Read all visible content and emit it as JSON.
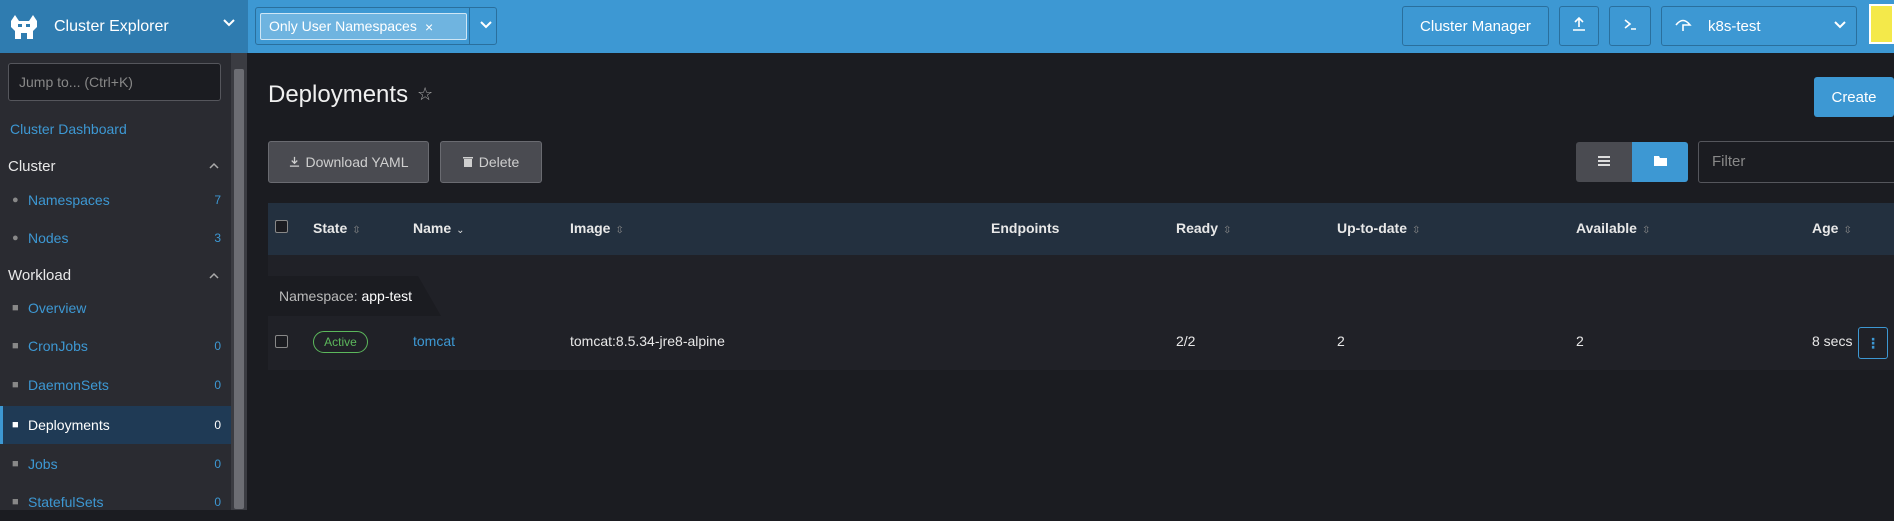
{
  "header": {
    "app_title": "Cluster Explorer",
    "namespace_filter": "Only User Namespaces",
    "namespace_remove": "×",
    "cluster_manager": "Cluster Manager",
    "cluster_name": "k8s-test"
  },
  "sidebar": {
    "jump_placeholder": "Jump to... (Ctrl+K)",
    "dashboard": "Cluster Dashboard",
    "groups": {
      "cluster": "Cluster",
      "workload": "Workload"
    },
    "cluster_items": [
      {
        "label": "Namespaces",
        "count": "7"
      },
      {
        "label": "Nodes",
        "count": "3"
      }
    ],
    "workload_items": [
      {
        "label": "Overview",
        "count": ""
      },
      {
        "label": "CronJobs",
        "count": "0"
      },
      {
        "label": "DaemonSets",
        "count": "0"
      },
      {
        "label": "Deployments",
        "count": "0"
      },
      {
        "label": "Jobs",
        "count": "0"
      },
      {
        "label": "StatefulSets",
        "count": "0"
      }
    ]
  },
  "main": {
    "title": "Deployments",
    "create": "Create",
    "download_yaml": "Download YAML",
    "delete": "Delete",
    "filter_placeholder": "Filter",
    "columns": {
      "state": "State",
      "name": "Name",
      "image": "Image",
      "endpoints": "Endpoints",
      "ready": "Ready",
      "uptodate": "Up-to-date",
      "available": "Available",
      "age": "Age"
    },
    "group": {
      "label": "Namespace:",
      "value": "app-test"
    },
    "rows": [
      {
        "state": "Active",
        "name": "tomcat",
        "image": "tomcat:8.5.34-jre8-alpine",
        "endpoints": "",
        "ready": "2/2",
        "uptodate": "2",
        "available": "2",
        "age": "8 secs"
      }
    ]
  },
  "colors": {
    "accent": "#3d98d3",
    "active_badge": "#5cb85c",
    "background": "#1b1c21"
  }
}
